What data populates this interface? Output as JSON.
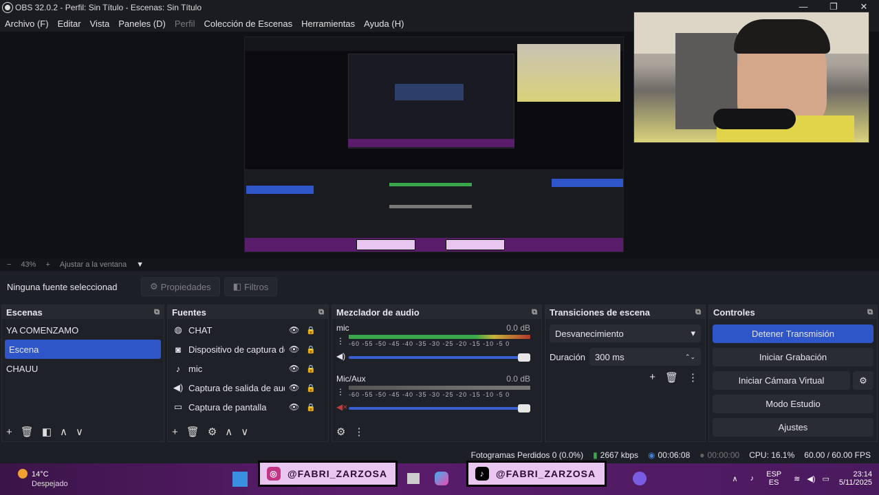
{
  "window": {
    "title": "OBS 32.0.2 - Perfil: Sin Título - Escenas: Sin Título",
    "minimize": "—",
    "maximize": "❐",
    "close": "✕"
  },
  "menu": [
    "Archivo (F)",
    "Editar",
    "Vista",
    "Paneles (D)",
    "Perfil",
    "Colección de Escenas",
    "Herramientas",
    "Ayuda (H)"
  ],
  "zoom": {
    "minus": "−",
    "value": "43%",
    "plus": "+",
    "fit": "Ajustar a la ventana",
    "arrow": "▼"
  },
  "source_toolbar": {
    "status": "Ninguna fuente seleccionad",
    "properties": "Propiedades",
    "filters": "Filtros"
  },
  "scenes": {
    "title": "Escenas",
    "items": [
      "YA COMENZAMO",
      "Escena",
      "CHAUU"
    ],
    "selected": 1
  },
  "sources": {
    "title": "Fuentes",
    "items": [
      {
        "icon": "globe-icon",
        "glyph": "◍",
        "name": "CHAT"
      },
      {
        "icon": "camera-icon",
        "glyph": "◙",
        "name": "Dispositivo de captura de"
      },
      {
        "icon": "mic-icon",
        "glyph": "♪",
        "name": "mic"
      },
      {
        "icon": "speaker-icon",
        "glyph": "◀)",
        "name": "Captura de salida de aud"
      },
      {
        "icon": "monitor-icon",
        "glyph": "▭",
        "name": "Captura de pantalla"
      }
    ]
  },
  "mixer": {
    "title": "Mezclador de audio",
    "channels": [
      {
        "name": "mic",
        "db": "0.0 dB",
        "level": 0.78,
        "muted": false
      },
      {
        "name": "Mic/Aux",
        "db": "0.0 dB",
        "level": 0.0,
        "muted": true
      }
    ],
    "ticks": "-60 -55 -50 -45 -40 -35 -30 -25 -20 -15 -10 -5 0"
  },
  "transitions": {
    "title": "Transiciones de escena",
    "selected": "Desvanecimiento",
    "duration_label": "Duración",
    "duration_value": "300 ms"
  },
  "controls": {
    "title": "Controles",
    "buttons": [
      "Detener Transmisión",
      "Iniciar Grabación",
      "Iniciar Cámara Virtual",
      "Modo Estudio",
      "Ajustes"
    ]
  },
  "status": {
    "dropped": "Fotogramas Perdidos 0 (0.0%)",
    "bitrate": "2667 kbps",
    "stream_time": "00:06:08",
    "rec_time": "00:00:00",
    "cpu": "CPU: 16.1%",
    "fps": "60.00 / 60.00 FPS"
  },
  "taskbar": {
    "temp": "14°C",
    "weather": "Despejado",
    "social1": "@FABRI_ZARZOSA",
    "social2": "@FABRI_ZARZOSA",
    "lang1": "ESP",
    "lang2": "ES",
    "time": "23:14",
    "date": "5/11/2025"
  },
  "colors": {
    "accent": "#2f56c8",
    "bg": "#1d1f26",
    "taskbar": "#4a1a5e"
  }
}
